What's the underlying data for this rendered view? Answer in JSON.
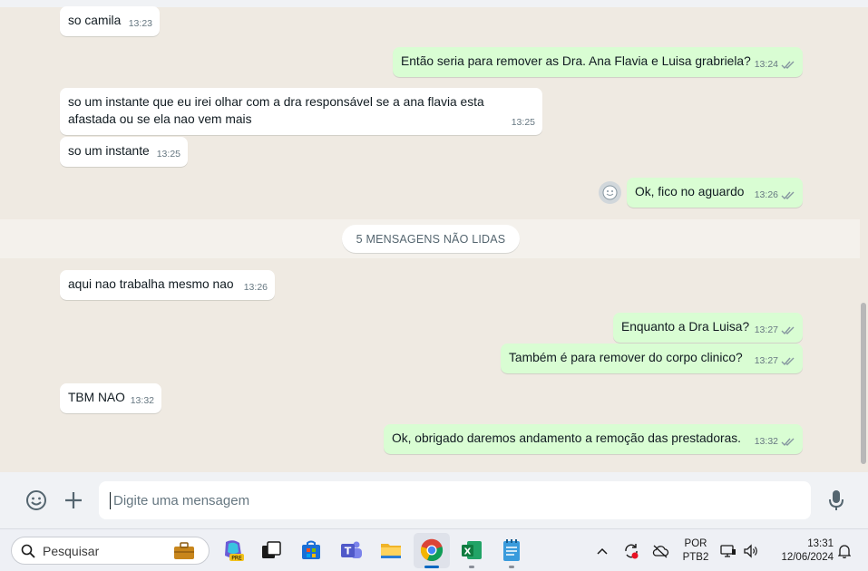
{
  "messages": [
    {
      "dir": "in",
      "text": "so camila",
      "time": "13:23"
    },
    {
      "dir": "out",
      "text": "Então seria para remover as Dra. Ana Flavia e Luisa grabriela?",
      "time": "13:24"
    },
    {
      "dir": "in",
      "text": "so um instante que eu irei olhar com a dra responsável se a ana flavia esta\nafastada ou se ela nao vem mais",
      "time": "13:25"
    },
    {
      "dir": "in",
      "text": "so um instante",
      "time": "13:25"
    },
    {
      "dir": "out",
      "text": "Ok, fico no aguardo",
      "time": "13:26"
    },
    {
      "dir": "in",
      "text": "aqui nao trabalha mesmo nao",
      "time": "13:26"
    },
    {
      "dir": "out",
      "text": "Enquanto a Dra Luisa?",
      "time": "13:27"
    },
    {
      "dir": "out",
      "text": "Também é para remover do corpo clinico?",
      "time": "13:27"
    },
    {
      "dir": "in",
      "text": "TBM NAO",
      "time": "13:32"
    },
    {
      "dir": "out",
      "text": "Ok, obrigado daremos andamento a remoção das prestadoras.",
      "time": "13:32"
    }
  ],
  "unread_banner": "5 MENSAGENS NÃO LIDAS",
  "composer": {
    "placeholder": "Digite uma mensagem",
    "emoji_icon": "smiley-icon",
    "attach_icon": "plus-icon",
    "mic_icon": "microphone-icon"
  },
  "taskbar": {
    "search_label": "Pesquisar",
    "apps": [
      "copilot-pre",
      "task-view",
      "microsoft-store",
      "teams",
      "file-explorer",
      "chrome",
      "excel",
      "notepad"
    ],
    "language": {
      "line1": "POR",
      "line2": "PTB2"
    },
    "time": "13:31",
    "date": "12/06/2024"
  },
  "colors": {
    "outgoing_bubble": "#d9fdd3",
    "incoming_bubble": "#ffffff",
    "chat_background": "#efeae2",
    "read_ticks": "#8696a0"
  }
}
